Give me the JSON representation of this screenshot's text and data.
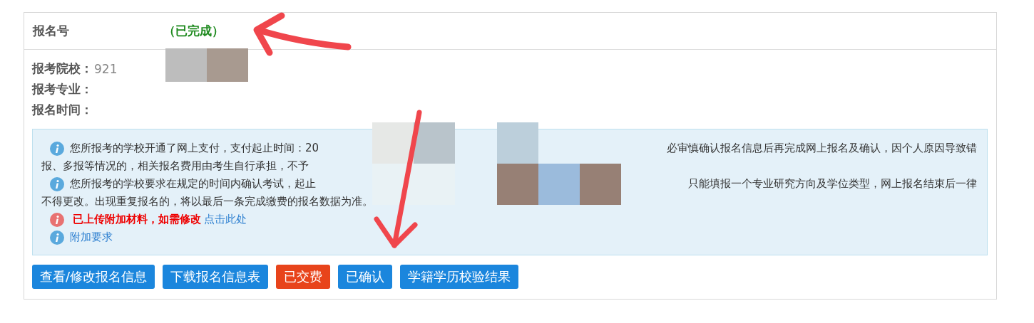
{
  "header": {
    "label": "报名号",
    "status": "（已完成）"
  },
  "fields": [
    {
      "label": "报考院校：",
      "value": "921"
    },
    {
      "label": "报考专业："
    },
    {
      "label": "报名时间："
    }
  ],
  "notices": [
    {
      "kind": "info",
      "lines": [
        [
          "您所报考的学校开通了网上支付，支付起止时间：20",
          "必审慎确认报名信息后再完成网上报名及确认，因个人原因导致错"
        ],
        [
          "报、多报等情况的，相关报名费用由考生自行承担，不予"
        ]
      ]
    },
    {
      "kind": "info",
      "lines": [
        [
          "您所报考的学校要求在规定的时间内确认考试，起止",
          "只能填报一个专业研究方向及学位类型，网上报名结束后一律"
        ],
        [
          "不得更改。出现重复报名的，将以最后一条完成缴费的报名数据为准。"
        ]
      ]
    },
    {
      "kind": "alert",
      "text": "已上传附加材料，如需修改",
      "link": "点击此处"
    },
    {
      "kind": "info",
      "link": "附加要求"
    }
  ],
  "buttons": [
    {
      "label": "查看/修改报名信息",
      "kind": "primary"
    },
    {
      "label": "下载报名信息表",
      "kind": "primary"
    },
    {
      "label": "已交费",
      "kind": "paid"
    },
    {
      "label": "已确认",
      "kind": "primary"
    },
    {
      "label": "学籍学历校验结果",
      "kind": "primary"
    }
  ]
}
